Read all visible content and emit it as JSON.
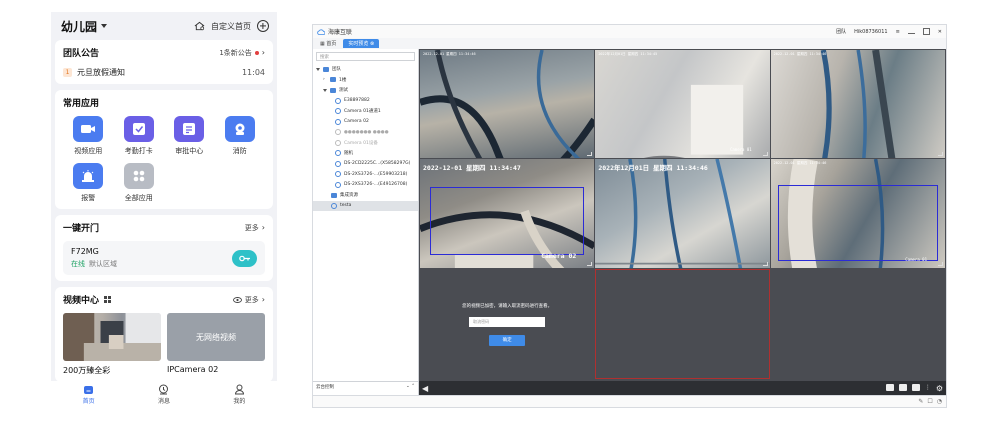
{
  "mobile": {
    "title": "幼儿园",
    "custom_home": "自定义首页",
    "notice": {
      "title": "团队公告",
      "unread": "1条新公告",
      "badge": "1",
      "item": "元旦放假通知",
      "time": "11:04"
    },
    "apps": {
      "title": "常用应用",
      "items": [
        {
          "label": "视频应用",
          "color": "#4b7cf0"
        },
        {
          "label": "考勤打卡",
          "color": "#6a5fe6"
        },
        {
          "label": "审批中心",
          "color": "#6a5fe6"
        },
        {
          "label": "消防",
          "color": "#4b7cf0"
        },
        {
          "label": "报警",
          "color": "#4b7cf0"
        },
        {
          "label": "全部应用",
          "color": "#b8bcc4"
        }
      ]
    },
    "door": {
      "title": "一键开门",
      "more": "更多",
      "device": "F72MG",
      "status": "在线",
      "area": "默认区域"
    },
    "video": {
      "title": "视频中心",
      "more": "更多",
      "cams": [
        {
          "caption": "200万臻全彩",
          "overlay": ""
        },
        {
          "caption": "IPCamera 02",
          "overlay": "无网络视频"
        }
      ]
    },
    "tabs": [
      {
        "label": "首页",
        "active": true
      },
      {
        "label": "消息",
        "active": false
      },
      {
        "label": "我的",
        "active": false
      }
    ]
  },
  "desktop": {
    "app_title": "海康互联",
    "user": "团队",
    "account": "Hik08736011",
    "tabs": [
      {
        "label": "首页",
        "active": false
      },
      {
        "label": "实时预览",
        "active": true
      }
    ],
    "search_placeholder": "搜索",
    "tree": [
      {
        "label": "团队",
        "level": 0,
        "kind": "org"
      },
      {
        "label": "1楼",
        "level": 1,
        "kind": "org"
      },
      {
        "label": "测试",
        "level": 1,
        "kind": "org"
      },
      {
        "label": "E38897882",
        "level": 2,
        "kind": "cam"
      },
      {
        "label": "Camera 01通道1",
        "level": 2,
        "kind": "cam"
      },
      {
        "label": "Camera 02",
        "level": 2,
        "kind": "cam"
      },
      {
        "label": "●●●●●●● ●●●●",
        "level": 2,
        "kind": "cam",
        "dim": true
      },
      {
        "label": "Camera 01设备",
        "level": 2,
        "kind": "cam",
        "dim": true
      },
      {
        "label": "随机",
        "level": 2,
        "kind": "cam"
      },
      {
        "label": "DS-2CD2225C...(X5858297G)",
        "level": 2,
        "kind": "cam"
      },
      {
        "label": "DS-2XS3726-...(E59903218)",
        "level": 2,
        "kind": "cam"
      },
      {
        "label": "DS-2XS3726-...(E49126708)",
        "level": 2,
        "kind": "cam"
      },
      {
        "label": "集成资源",
        "level": 1,
        "kind": "org"
      },
      {
        "label": "testa",
        "level": 1,
        "kind": "cam",
        "selected": true
      }
    ],
    "ptz_label": "云台控制",
    "cells": [
      {
        "osd": "2022-12-01 星期四 11:34:46",
        "cam": "",
        "big": false
      },
      {
        "osd": "2022年12月01日 星期四 11:34:45",
        "cam": "Camera 01",
        "big": false
      },
      {
        "osd": "2022-12-01 星期四 11:34:46",
        "cam": "",
        "big": false
      },
      {
        "osd": "2022-12-01 星期四 11:34:47",
        "cam": "Camera 02",
        "big": true
      },
      {
        "osd": "2022年12月01日 星期四 11:34:46",
        "cam": "",
        "big": true
      },
      {
        "osd": "2022-12-01 星期四 11:34:46",
        "cam": "Camera 01",
        "big": false
      }
    ],
    "encrypted": {
      "message": "您的视频已加密，请输入取流密码进行查看。",
      "input_placeholder": "取流密码",
      "confirm": "确定"
    }
  }
}
